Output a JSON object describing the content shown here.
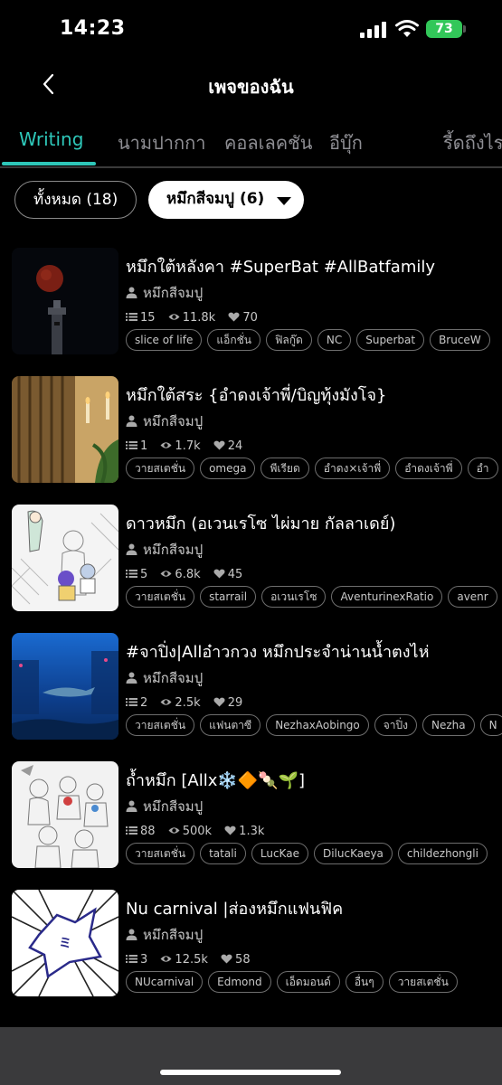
{
  "status": {
    "time": "14:23",
    "battery": "73"
  },
  "header": {
    "title": "เพจของฉัน"
  },
  "tabs": [
    "Writing",
    "นามปากกา",
    "คอลเลคชัน",
    "อีบุ๊ก",
    "รี้ดถึงไร"
  ],
  "filters": {
    "all_label": "ทั้งหมด (18)",
    "pen_label": "หมึกสีจมปู (6)"
  },
  "items": [
    {
      "title": "หมึกใต้หลังคา #SuperBat #AllBatfamily",
      "author": "หมึกสีจมปู",
      "chapters": "15",
      "views": "11.8k",
      "likes": "70",
      "tags": [
        "slice of life",
        "แอ็กชั่น",
        "ฟิลกู๊ด",
        "NC",
        "Superbat",
        "BruceW"
      ]
    },
    {
      "title": "หมึกใต้สระ {อำดงเจ้าพี่/บิญทุ้งมังโจ}",
      "author": "หมึกสีจมปู",
      "chapters": "1",
      "views": "1.7k",
      "likes": "24",
      "tags": [
        "วายสเตชั่น",
        "omega",
        "พีเรียด",
        "อำดง×เจ้าพี่",
        "อำดงเจ้าพี่",
        "อำ"
      ]
    },
    {
      "title": "ดาวหมึก (อเวนเรโซ ไผ่มาย กัลลาเดย์)",
      "author": "หมึกสีจมปู",
      "chapters": "5",
      "views": "6.8k",
      "likes": "45",
      "tags": [
        "วายสเตชั่น",
        "starrail",
        "อเวนเรโซ",
        "AventurinexRatio",
        "avenr"
      ]
    },
    {
      "title": "#จาปิ่ง|Allอ๋าวกวง หมึกประจำน่านน้ำตงไห่",
      "author": "หมึกสีจมปู",
      "chapters": "2",
      "views": "2.5k",
      "likes": "29",
      "tags": [
        "วายสเตชั่น",
        "แฟนตาซี",
        "NezhaxAobingo",
        "จาปิ่ง",
        "Nezha",
        "N"
      ]
    },
    {
      "title": "ถ้ำหมึก [Allx❄️🔶🍡🌱]",
      "author": "หมึกสีจมปู",
      "chapters": "88",
      "views": "500k",
      "likes": "1.3k",
      "tags": [
        "วายสเตชั่น",
        "tatali",
        "LucKae",
        "DilucKaeya",
        "childezhongli"
      ]
    },
    {
      "title": "Nu carnival |ส่องหมึกแฟนฟิค",
      "author": "หมึกสีจมปู",
      "chapters": "3",
      "views": "12.5k",
      "likes": "58",
      "tags": [
        "NUcarnival",
        "Edmond",
        "เอ็ดมอนด์",
        "อื่นๆ",
        "วายสเตชั่น"
      ]
    }
  ],
  "colors": {
    "accent": "#2ec7b9",
    "background": "#000000",
    "battery": "#32c759"
  }
}
